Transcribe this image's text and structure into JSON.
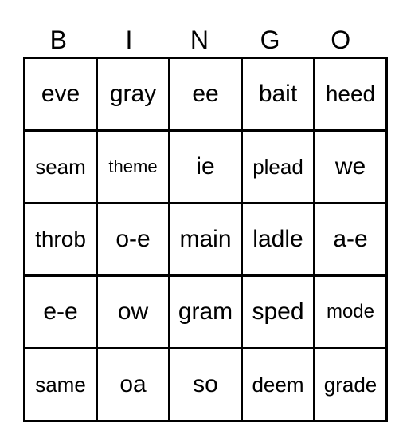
{
  "title_letters": [
    "B",
    "I",
    "N",
    "G",
    "O"
  ],
  "cells": [
    [
      "eve",
      "gray",
      "ee",
      "bait",
      "heed"
    ],
    [
      "seam",
      "theme",
      "ie",
      "plead",
      "we"
    ],
    [
      "throb",
      "o-e",
      "main",
      "ladle",
      "a-e"
    ],
    [
      "e-e",
      "ow",
      "gram",
      "sped",
      "mode"
    ],
    [
      "same",
      "oa",
      "so",
      "deem",
      "grade"
    ]
  ]
}
